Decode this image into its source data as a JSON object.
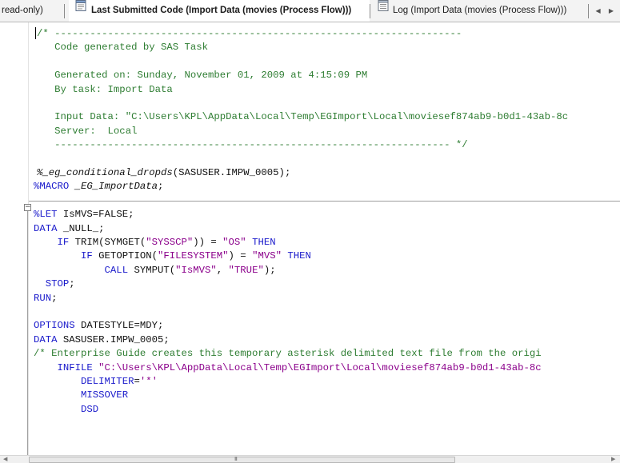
{
  "tabs": [
    {
      "label": "read-only)",
      "icon": "none"
    },
    {
      "label": "Last Submitted Code (Import Data (movies (Process Flow)))",
      "icon": "code-document-icon",
      "active": true
    },
    {
      "label": "Log (Import Data (movies (Process Flow)))",
      "icon": "log-document-icon"
    }
  ],
  "nav": {
    "arrows": "◀ ▶"
  },
  "code": {
    "lines": [
      [
        {
          "c": "comment",
          "t": "/* ---------------------------------------------------------------------"
        }
      ],
      [
        {
          "c": "comment",
          "t": "   Code generated by SAS Task"
        }
      ],
      [
        {
          "c": "comment",
          "t": ""
        }
      ],
      [
        {
          "c": "comment",
          "t": "   Generated on: Sunday, November 01, 2009 at 4:15:09 PM"
        }
      ],
      [
        {
          "c": "comment",
          "t": "   By task: Import Data"
        }
      ],
      [
        {
          "c": "comment",
          "t": ""
        }
      ],
      [
        {
          "c": "comment",
          "t": "   Input Data: \"C:\\Users\\KPL\\AppData\\Local\\Temp\\EGImport\\Local\\moviesef874ab9-b0d1-43ab-8c"
        }
      ],
      [
        {
          "c": "comment",
          "t": "   Server:  Local"
        }
      ],
      [
        {
          "c": "comment",
          "t": "   ------------------------------------------------------------------- */"
        }
      ],
      [
        {
          "c": "plain",
          "t": ""
        }
      ],
      [
        {
          "c": "macrocall",
          "t": "%_eg_conditional_dropds"
        },
        {
          "c": "plain",
          "t": "(SASUSER.IMPW_0005);"
        }
      ],
      [
        {
          "c": "macro",
          "t": "%MACRO "
        },
        {
          "c": "macrocall",
          "t": "_EG_ImportData"
        },
        {
          "c": "plain",
          "t": ";"
        }
      ],
      [
        {
          "c": "plain",
          "t": ""
        }
      ],
      [
        {
          "c": "kw",
          "t": "%LET"
        },
        {
          "c": "plain",
          "t": " IsMVS=FALSE;"
        }
      ],
      [
        {
          "c": "kw",
          "t": "DATA"
        },
        {
          "c": "plain",
          "t": " _NULL_;"
        }
      ],
      [
        {
          "c": "kw",
          "t": "    IF"
        },
        {
          "c": "plain",
          "t": " TRIM(SYMGET("
        },
        {
          "c": "str",
          "t": "\"SYSSCP\""
        },
        {
          "c": "plain",
          "t": ")) = "
        },
        {
          "c": "str",
          "t": "\"OS\""
        },
        {
          "c": "kw",
          "t": " THEN"
        }
      ],
      [
        {
          "c": "kw",
          "t": "        IF"
        },
        {
          "c": "plain",
          "t": " GETOPTION("
        },
        {
          "c": "str",
          "t": "\"FILESYSTEM\""
        },
        {
          "c": "plain",
          "t": ") = "
        },
        {
          "c": "str",
          "t": "\"MVS\""
        },
        {
          "c": "kw",
          "t": " THEN"
        }
      ],
      [
        {
          "c": "kw",
          "t": "            CALL"
        },
        {
          "c": "plain",
          "t": " SYMPUT("
        },
        {
          "c": "str",
          "t": "\"IsMVS\""
        },
        {
          "c": "plain",
          "t": ", "
        },
        {
          "c": "str",
          "t": "\"TRUE\""
        },
        {
          "c": "plain",
          "t": ");"
        }
      ],
      [
        {
          "c": "kw",
          "t": "  STOP"
        },
        {
          "c": "plain",
          "t": ";"
        }
      ],
      [
        {
          "c": "kw",
          "t": "RUN"
        },
        {
          "c": "plain",
          "t": ";"
        }
      ],
      [
        {
          "c": "plain",
          "t": ""
        }
      ],
      [
        {
          "c": "kw",
          "t": "OPTIONS"
        },
        {
          "c": "plain",
          "t": " DATESTYLE=MDY;"
        }
      ],
      [
        {
          "c": "kw",
          "t": "DATA"
        },
        {
          "c": "plain",
          "t": " SASUSER.IMPW_0005;"
        }
      ],
      [
        {
          "c": "comment",
          "t": "/* Enterprise Guide creates this temporary asterisk delimited text file from the origi"
        }
      ],
      [
        {
          "c": "kw",
          "t": "    INFILE"
        },
        {
          "c": "str",
          "t": " \"C:\\Users\\KPL\\AppData\\Local\\Temp\\EGImport\\Local\\moviesef874ab9-b0d1-43ab-8c"
        }
      ],
      [
        {
          "c": "kw",
          "t": "        DELIMITER"
        },
        {
          "c": "plain",
          "t": "="
        },
        {
          "c": "str",
          "t": "'*'"
        }
      ],
      [
        {
          "c": "kw",
          "t": "        MISSOVER"
        }
      ],
      [
        {
          "c": "kw",
          "t": "        DSD"
        }
      ]
    ]
  },
  "scrollbar": {
    "grip": "III",
    "left_arrow": "◀",
    "right_arrow": "▶"
  }
}
